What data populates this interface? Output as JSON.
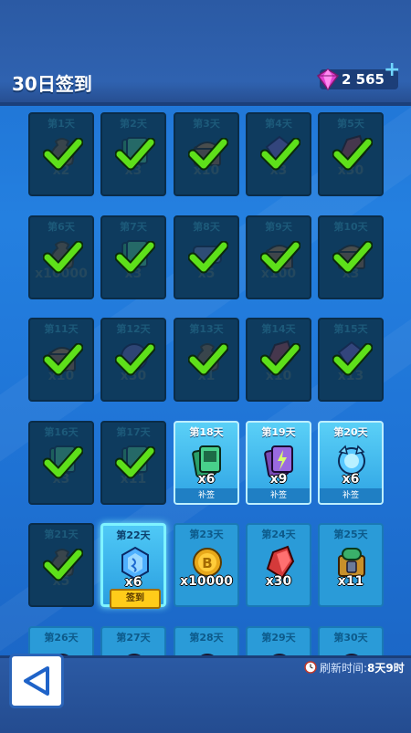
{
  "header": {
    "title": "30日签到",
    "gems": "2 565",
    "plus": "+"
  },
  "days": [
    {
      "label": "第1天",
      "qty": "x2",
      "state": "claimed",
      "icon": "sack-icon"
    },
    {
      "label": "第2天",
      "qty": "x3",
      "state": "claimed",
      "icon": "cards-icon"
    },
    {
      "label": "第3天",
      "qty": "x10",
      "state": "claimed",
      "icon": "chest-icon"
    },
    {
      "label": "第4天",
      "qty": "x3",
      "state": "claimed",
      "icon": "gem-icon"
    },
    {
      "label": "第5天",
      "qty": "x30",
      "state": "claimed",
      "icon": "crystal-icon"
    },
    {
      "label": "第6天",
      "qty": "x10000",
      "state": "claimed",
      "icon": "sack-icon"
    },
    {
      "label": "第7天",
      "qty": "x3",
      "state": "claimed",
      "icon": "cards-icon"
    },
    {
      "label": "第8天",
      "qty": "x5",
      "state": "claimed",
      "icon": "scroll-icon"
    },
    {
      "label": "第9天",
      "qty": "x100",
      "state": "claimed",
      "icon": "chest-icon"
    },
    {
      "label": "第10天",
      "qty": "x3",
      "state": "claimed",
      "icon": "chest-icon"
    },
    {
      "label": "第11天",
      "qty": "x10",
      "state": "claimed",
      "icon": "chest-icon"
    },
    {
      "label": "第12天",
      "qty": "x30",
      "state": "claimed",
      "icon": "orb-icon"
    },
    {
      "label": "第13天",
      "qty": "x1",
      "state": "claimed",
      "icon": "sack-icon"
    },
    {
      "label": "第14天",
      "qty": "x10",
      "state": "claimed",
      "icon": "crystal-icon"
    },
    {
      "label": "第15天",
      "qty": "x13",
      "state": "claimed",
      "icon": "gem-icon"
    },
    {
      "label": "第16天",
      "qty": "x3",
      "state": "claimed",
      "icon": "cards-icon"
    },
    {
      "label": "第17天",
      "qty": "x11",
      "state": "claimed",
      "icon": "cards-icon"
    },
    {
      "label": "第18天",
      "qty": "x6",
      "state": "makeup",
      "icon": "green-cards-icon",
      "badge": "补签"
    },
    {
      "label": "第19天",
      "qty": "x9",
      "state": "makeup",
      "icon": "purple-cards-icon",
      "badge": "补签"
    },
    {
      "label": "第20天",
      "qty": "x6",
      "state": "makeup",
      "icon": "blue-orb-icon",
      "badge": "补签"
    },
    {
      "label": "第21天",
      "qty": "x5",
      "state": "claimed",
      "icon": "sack-icon"
    },
    {
      "label": "第22天",
      "qty": "x6",
      "state": "today",
      "icon": "blue-gem-icon",
      "badge": "签到"
    },
    {
      "label": "第23天",
      "qty": "x10000",
      "state": "future",
      "icon": "coin-icon"
    },
    {
      "label": "第24天",
      "qty": "x30",
      "state": "future",
      "icon": "red-crystal-icon"
    },
    {
      "label": "第25天",
      "qty": "x11",
      "state": "future",
      "icon": "lock-chest-icon"
    },
    {
      "label": "第26天",
      "qty": "",
      "state": "future",
      "icon": "item-icon"
    },
    {
      "label": "第27天",
      "qty": "",
      "state": "future",
      "icon": "item-icon"
    },
    {
      "label": "第28天",
      "qty": "",
      "state": "future",
      "icon": "item-icon"
    },
    {
      "label": "第29天",
      "qty": "",
      "state": "future",
      "icon": "item-icon"
    },
    {
      "label": "第30天",
      "qty": "",
      "state": "future",
      "icon": "item-icon"
    }
  ],
  "footer": {
    "refresh_label": "刷新时间:",
    "refresh_value": "8天9时"
  },
  "colors": {
    "check_green": "#5ee01a",
    "gem_pink": "#e23fd0"
  }
}
